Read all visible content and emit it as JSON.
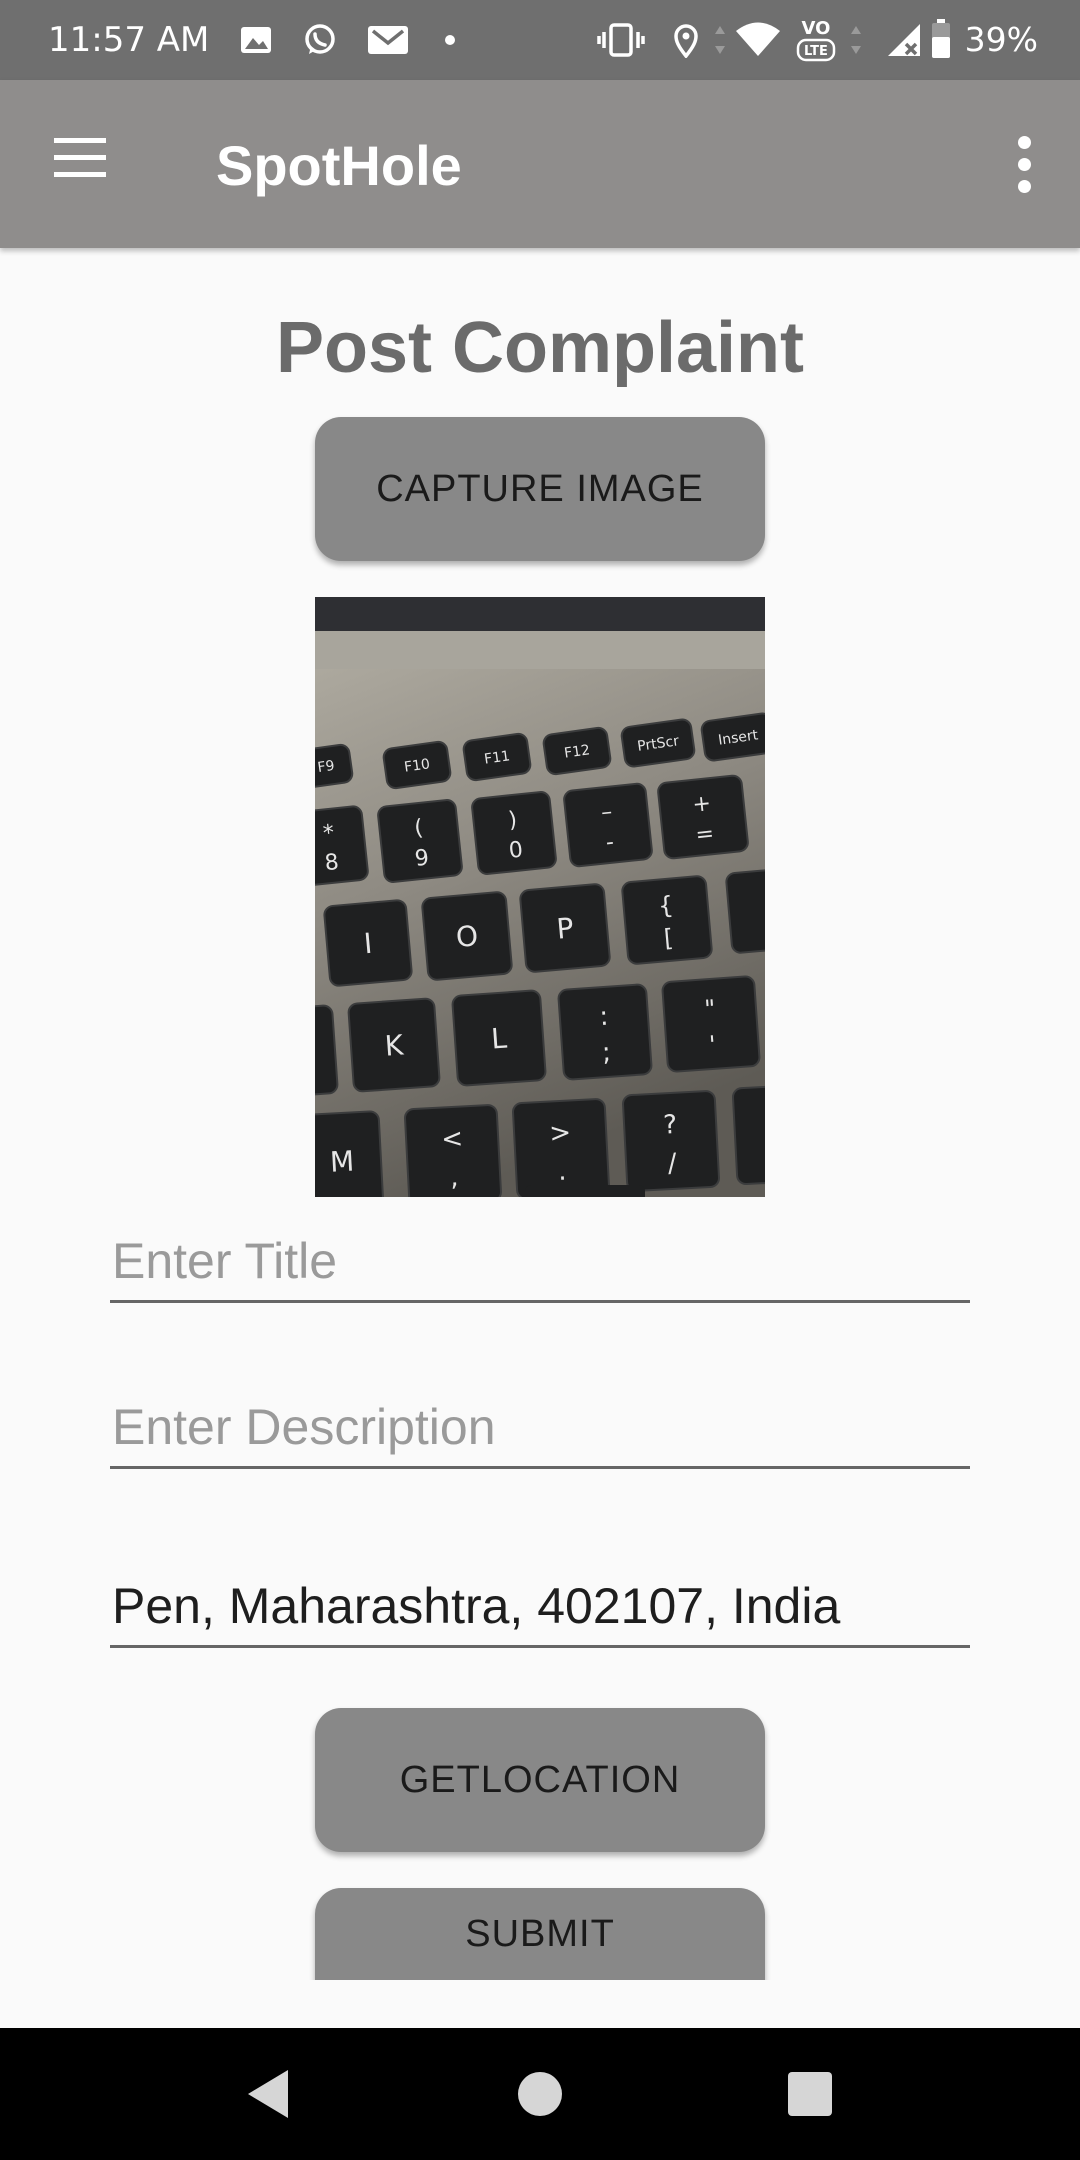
{
  "status_bar": {
    "time": "11:57 AM",
    "battery_percent": "39%",
    "left_icons": [
      "gallery-icon",
      "whatsapp-icon",
      "gmail-icon",
      "dot-icon"
    ],
    "right_icons": [
      "vibrate-icon",
      "location-icon",
      "wifi-icon",
      "volte-icon",
      "signal-icon",
      "battery-icon"
    ]
  },
  "app_bar": {
    "title": "SpotHole",
    "menu_icon": "hamburger-menu-icon",
    "overflow_icon": "more-vert-icon"
  },
  "page": {
    "heading": "Post Complaint",
    "capture_button": "CAPTURE IMAGE",
    "title_placeholder": "Enter Title",
    "description_placeholder": "Enter Description",
    "location_value": "Pen, Maharashtra, 402107, India",
    "getlocation_button": "GETLOCATION",
    "submit_button": "SUBMIT"
  },
  "captured_photo": {
    "key_labels": [
      "F9",
      "F10",
      "F11",
      "F12",
      "PrtScr",
      "Insert",
      "*",
      "8",
      "(",
      "9",
      ")",
      "0",
      "–",
      "-",
      "+",
      "=",
      "I",
      "O",
      "P",
      "{",
      "[",
      "K",
      "L",
      ":",
      ";",
      "\"",
      "'",
      "M",
      "<",
      ",",
      ">",
      ".",
      "?",
      "/"
    ]
  },
  "nav_bar": {
    "back_icon": "back-triangle-icon",
    "home_icon": "home-circle-icon",
    "recents_icon": "recents-square-icon"
  }
}
